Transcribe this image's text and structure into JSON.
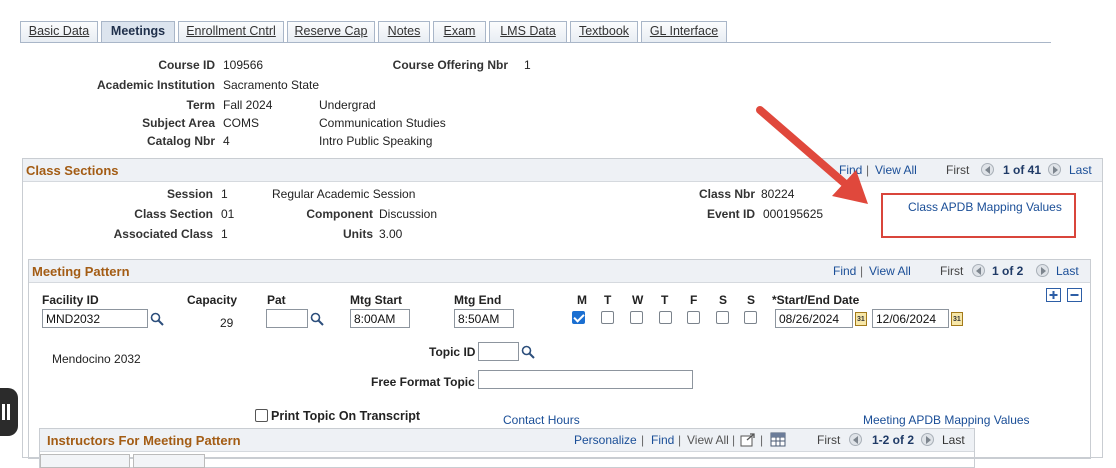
{
  "tabs": [
    {
      "label": "Basic Data",
      "active": false
    },
    {
      "label": "Meetings",
      "active": true
    },
    {
      "label": "Enrollment Cntrl",
      "active": false
    },
    {
      "label": "Reserve Cap",
      "active": false
    },
    {
      "label": "Notes",
      "active": false
    },
    {
      "label": "Exam",
      "active": false
    },
    {
      "label": "LMS Data",
      "active": false
    },
    {
      "label": "Textbook",
      "active": false
    },
    {
      "label": "GL Interface",
      "active": false
    }
  ],
  "course": {
    "course_id_label": "Course ID",
    "course_id": "109566",
    "offering_label": "Course Offering Nbr",
    "offering": "1",
    "institution_label": "Academic Institution",
    "institution": "Sacramento State",
    "term_label": "Term",
    "term": "Fall 2024",
    "career": "Undergrad",
    "subject_label": "Subject Area",
    "subject": "COMS",
    "subject_desc": "Communication Studies",
    "catalog_label": "Catalog Nbr",
    "catalog": "4",
    "catalog_desc": "Intro Public Speaking"
  },
  "class_sections": {
    "title": "Class Sections",
    "find": "Find",
    "pipe": "|",
    "view_all": "View All",
    "first": "First",
    "count": "1 of 41",
    "last": "Last",
    "session_label": "Session",
    "session": "1",
    "session_desc": "Regular Academic Session",
    "class_nbr_label": "Class Nbr",
    "class_nbr": "80224",
    "section_label": "Class Section",
    "section": "01",
    "component_label": "Component",
    "component": "Discussion",
    "event_label": "Event ID",
    "event": "000195625",
    "assoc_label": "Associated Class",
    "assoc": "1",
    "units_label": "Units",
    "units": "3.00",
    "apdb_link": "Class APDB Mapping Values"
  },
  "meeting_pattern": {
    "title": "Meeting Pattern",
    "find": "Find",
    "pipe": "|",
    "view_all": "View All",
    "first": "First",
    "count": "1 of 2",
    "last": "Last",
    "facility_label": "Facility ID",
    "facility": "MND2032",
    "capacity_label": "Capacity",
    "capacity": "29",
    "pat_label": "Pat",
    "pat": "",
    "start_label": "Mtg Start",
    "start": "8:00AM",
    "end_label": "Mtg End",
    "end": "8:50AM",
    "days": [
      {
        "label": "M",
        "checked": true
      },
      {
        "label": "T",
        "checked": false
      },
      {
        "label": "W",
        "checked": false
      },
      {
        "label": "T",
        "checked": false
      },
      {
        "label": "F",
        "checked": false
      },
      {
        "label": "S",
        "checked": false
      },
      {
        "label": "S",
        "checked": false
      }
    ],
    "dates_label": "*Start/End Date",
    "start_date": "08/26/2024",
    "end_date": "12/06/2024",
    "facility_desc": "Mendocino  2032",
    "topic_label": "Topic ID",
    "topic": "",
    "free_format_label": "Free Format Topic",
    "free_format": "",
    "print_topic_label": "Print Topic On Transcript",
    "contact_hours": "Contact Hours",
    "meeting_apdb_link": "Meeting APDB Mapping Values"
  },
  "instructors": {
    "title": "Instructors For Meeting Pattern",
    "personalize": "Personalize",
    "pipe": "|",
    "find": "Find",
    "view_all": "View All",
    "first": "First",
    "count": "1-2 of 2",
    "last": "Last"
  },
  "colors": {
    "accent_orange": "#a35c14",
    "link_blue": "#1a4e97",
    "callout_red": "#d9453b"
  }
}
